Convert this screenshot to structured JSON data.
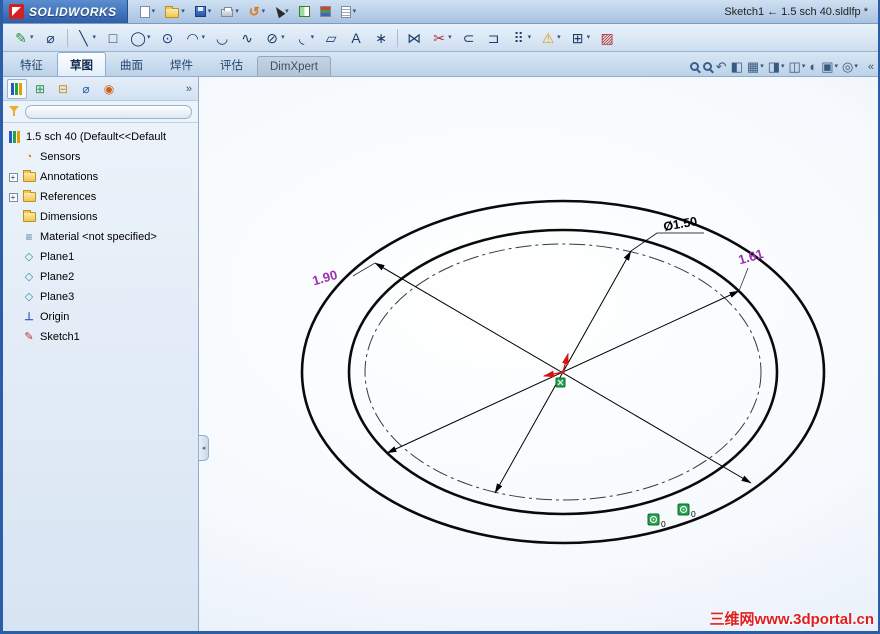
{
  "ui": {
    "caret": "▾",
    "plus": "+",
    "tabs_overflow": "«",
    "panel_overflow": "»",
    "splitter": "◂"
  },
  "window": {
    "app_name": "SOLIDWORKS",
    "title": "Sketch1 ← 1.5 sch 40.sldlfp *"
  },
  "standard_toolbar": {
    "items": [
      {
        "name": "new-document"
      },
      {
        "name": "open"
      },
      {
        "name": "save"
      },
      {
        "name": "print"
      },
      {
        "name": "undo",
        "glyph": "↺"
      },
      {
        "name": "select"
      },
      {
        "name": "toggle-display-pane"
      },
      {
        "name": "appearance-colors"
      },
      {
        "name": "file-properties"
      }
    ]
  },
  "sketch_toolbar": {
    "items": [
      {
        "name": "sketch",
        "glyph": "✎"
      },
      {
        "name": "smart-dimension",
        "glyph": "⌀"
      },
      {
        "name": "line",
        "glyph": "╲"
      },
      {
        "name": "corner-rectangle",
        "glyph": "□"
      },
      {
        "name": "circle",
        "glyph": "◯"
      },
      {
        "name": "perimeter-circle",
        "glyph": "⊙"
      },
      {
        "name": "centerpoint-arc",
        "glyph": "◠"
      },
      {
        "name": "tangent-arc",
        "glyph": "◡"
      },
      {
        "name": "spline",
        "glyph": "∿"
      },
      {
        "name": "ellipse",
        "glyph": "⊘"
      },
      {
        "name": "sketch-fillet",
        "glyph": "◟"
      },
      {
        "name": "plane",
        "glyph": "▱"
      },
      {
        "name": "text",
        "glyph": "A"
      },
      {
        "name": "point",
        "glyph": "∗"
      },
      {
        "name": "mirror-entities",
        "glyph": "⋈"
      },
      {
        "name": "trim-entities",
        "glyph": "✂"
      },
      {
        "name": "convert-entities",
        "glyph": "⊂"
      },
      {
        "name": "offset-entities",
        "glyph": "⊐"
      },
      {
        "name": "linear-sketch-pattern",
        "glyph": "⠿"
      },
      {
        "name": "display-relations",
        "glyph": "⚠"
      },
      {
        "name": "quick-snaps",
        "glyph": "⊞"
      },
      {
        "name": "sketch-picture",
        "glyph": "▨"
      }
    ]
  },
  "command_tabs": {
    "tabs": [
      {
        "label": "特征"
      },
      {
        "label": "草图"
      },
      {
        "label": "曲面"
      },
      {
        "label": "焊件"
      },
      {
        "label": "评估"
      },
      {
        "label": "DimXpert"
      }
    ]
  },
  "view_toolbar": {
    "items": [
      {
        "name": "zoom-to-fit"
      },
      {
        "name": "zoom-to-area"
      },
      {
        "name": "previous-view",
        "glyph": "↶"
      },
      {
        "name": "section-view",
        "glyph": "◧"
      },
      {
        "name": "view-orientation",
        "glyph": "▦"
      },
      {
        "name": "display-style",
        "glyph": "◨"
      },
      {
        "name": "hide-show-items",
        "glyph": "◫"
      },
      {
        "name": "edit-appearance",
        "glyph": "◐"
      },
      {
        "name": "apply-scene",
        "glyph": "▣"
      },
      {
        "name": "view-settings",
        "glyph": "◎"
      }
    ]
  },
  "manager_tabs": {
    "items": [
      {
        "name": "featuremanager-tree"
      },
      {
        "name": "propertymanager",
        "glyph": "⊞"
      },
      {
        "name": "configurationmanager",
        "glyph": "⊟"
      },
      {
        "name": "dimxpertmanager",
        "glyph": "⌀"
      },
      {
        "name": "displaymanager",
        "glyph": "◉"
      }
    ]
  },
  "feature_tree": {
    "root_label": "1.5 sch 40  (Default<<Default",
    "items": [
      {
        "label": "Sensors"
      },
      {
        "label": "Annotations"
      },
      {
        "label": "References"
      },
      {
        "label": "Dimensions"
      },
      {
        "label": "Material <not specified>"
      },
      {
        "label": "Plane1"
      },
      {
        "label": "Plane2"
      },
      {
        "label": "Plane3"
      },
      {
        "label": "Origin"
      },
      {
        "label": "Sketch1"
      }
    ]
  },
  "sketch_view": {
    "dim_nominal_label": "Ø1.50",
    "dim_outer_label": "1.90",
    "dim_inner_label": "1.61",
    "badge1": "0",
    "badge2": "0",
    "colors": {
      "dimension_purple": "#9b30b0",
      "relation_green": "#27a34d"
    }
  },
  "watermark": "三维网www.3dportal.cn"
}
